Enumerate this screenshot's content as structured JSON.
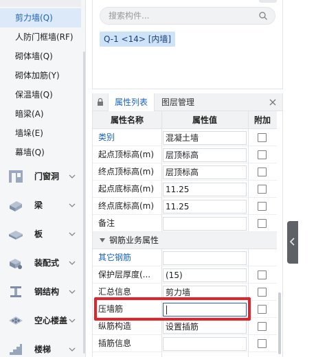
{
  "nav": {
    "sub_items": [
      {
        "label": "剪力墙(Q)",
        "active": true
      },
      {
        "label": "人防门框墙(RF)",
        "active": false
      },
      {
        "label": "砌体墙(Q)",
        "active": false
      },
      {
        "label": "砌体加筋(Y)",
        "active": false
      },
      {
        "label": "保温墙(Q)",
        "active": false
      },
      {
        "label": "暗梁(A)",
        "active": false
      },
      {
        "label": "墙垛(E)",
        "active": false
      },
      {
        "label": "幕墙(Q)",
        "active": false
      }
    ],
    "categories": [
      {
        "label": "门窗洞",
        "icon": "door-window-icon"
      },
      {
        "label": "梁",
        "icon": "beam-icon"
      },
      {
        "label": "板",
        "icon": "slab-icon"
      },
      {
        "label": "装配式",
        "icon": "prefab-icon"
      },
      {
        "label": "钢结构",
        "icon": "steel-structure-icon"
      },
      {
        "label": "空心楼盖",
        "icon": "hollow-floor-icon"
      },
      {
        "label": "楼梯",
        "icon": "stair-icon"
      }
    ]
  },
  "search": {
    "placeholder": "搜索构件...",
    "selected_chip": "Q-1 <14> [内墙]"
  },
  "props": {
    "tabs": [
      "属性列表",
      "图层管理"
    ],
    "active_tab": "属性列表",
    "columns": [
      "属性名称",
      "属性值",
      "附加"
    ],
    "rows": [
      {
        "name": "类别",
        "value": "混凝土墙",
        "link": true
      },
      {
        "name": "起点顶标高(m)",
        "value": "层顶标高",
        "link": false
      },
      {
        "name": "终点顶标高(m)",
        "value": "层顶标高",
        "link": false
      },
      {
        "name": "起点底标高(m)",
        "value": "11.25",
        "link": false
      },
      {
        "name": "终点底标高(m)",
        "value": "11.25",
        "link": false
      },
      {
        "name": "备注",
        "value": "",
        "link": false
      }
    ],
    "group": {
      "label": "钢筋业务属性"
    },
    "group_rows": [
      {
        "name": "其它钢筋",
        "value": "",
        "link": true
      },
      {
        "name": "保护层厚度(...",
        "value": "(15)",
        "link": false
      },
      {
        "name": "汇总信息",
        "value": "剪力墙",
        "link": false
      },
      {
        "name": "压墙筋",
        "value": "",
        "link": false,
        "focused": true
      },
      {
        "name": "纵筋构造",
        "value": "设置插筋",
        "link": false
      },
      {
        "name": "插筋信息",
        "value": "",
        "link": false
      }
    ]
  },
  "colors": {
    "accent": "#1b63c5",
    "highlight": "#e2242a",
    "active_bg": "#dce9f8",
    "chip_bg": "#cfe3f8"
  }
}
